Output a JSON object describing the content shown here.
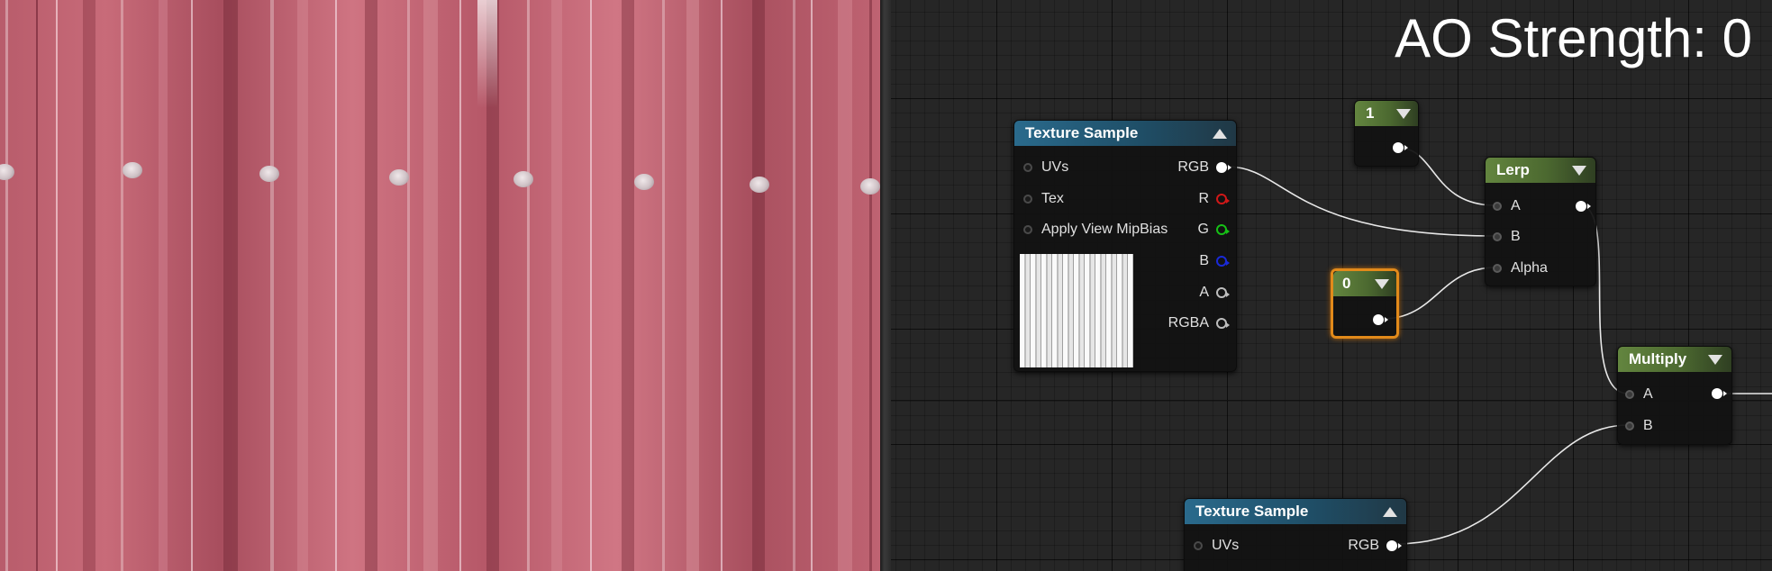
{
  "overlay": {
    "ao_strength": "AO Strength: 0"
  },
  "viewport": {
    "base_color": "#b85c6b"
  },
  "nodes": {
    "texture_sample_1": {
      "title": "Texture Sample",
      "inputs": [
        "UVs",
        "Tex",
        "Apply View MipBias"
      ],
      "outputs": [
        {
          "label": "RGB",
          "color": "#ffffff"
        },
        {
          "label": "R",
          "color": "#d01818"
        },
        {
          "label": "G",
          "color": "#16c016"
        },
        {
          "label": "B",
          "color": "#1a2ad8"
        },
        {
          "label": "A",
          "color": "#bdbdbd"
        },
        {
          "label": "RGBA",
          "color": "#bdbdbd"
        }
      ]
    },
    "const_one": {
      "value": "1"
    },
    "const_zero": {
      "value": "0"
    },
    "lerp": {
      "title": "Lerp",
      "inputs": [
        "A",
        "B",
        "Alpha"
      ]
    },
    "multiply": {
      "title": "Multiply",
      "inputs": [
        "A",
        "B"
      ]
    },
    "texture_sample_2": {
      "title": "Texture Sample",
      "inputs": [
        "UVs"
      ],
      "outputs": [
        {
          "label": "RGB",
          "color": "#ffffff"
        }
      ]
    }
  },
  "colors": {
    "header_blue": "#2a6a8c",
    "header_green": "#63853f",
    "selection": "#e28a1a",
    "wire": "#e8e8e8"
  }
}
